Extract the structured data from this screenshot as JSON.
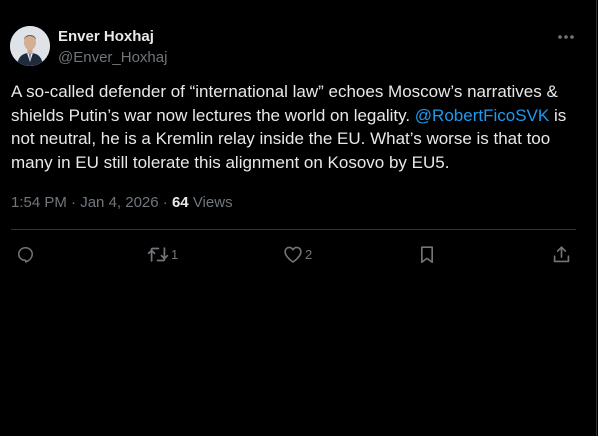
{
  "author": {
    "display_name": "Enver Hoxhaj",
    "handle": "@Enver_Hoxhaj",
    "avatar_icon": "profile-photo-avatar"
  },
  "tweet": {
    "text_part1": "A so-called defender of “international law” echoes Moscow’s narratives & shields Putin’s war now lectures the world on legality. ",
    "mention": "@RobertFicoSVK",
    "text_part2": " is not neutral, he is a Kremlin relay inside the EU. What’s worse is that too many in EU still tolerate this alignment on Kosovo by EU5."
  },
  "meta": {
    "time": "1:54 PM",
    "separator": " · ",
    "date": "Jan 4, 2026",
    "views_count": "64",
    "views_label": "Views"
  },
  "actions": {
    "reply": {
      "icon": "reply-icon",
      "count": ""
    },
    "repost": {
      "icon": "repost-icon",
      "count": "1"
    },
    "like": {
      "icon": "heart-icon",
      "count": "2"
    },
    "bookmark": {
      "icon": "bookmark-icon",
      "count": ""
    },
    "share": {
      "icon": "share-icon",
      "count": ""
    }
  },
  "colors": {
    "background": "#000000",
    "text": "#e7e9ea",
    "muted": "#71767b",
    "link": "#1d9bf0",
    "divider": "#2f3336"
  }
}
